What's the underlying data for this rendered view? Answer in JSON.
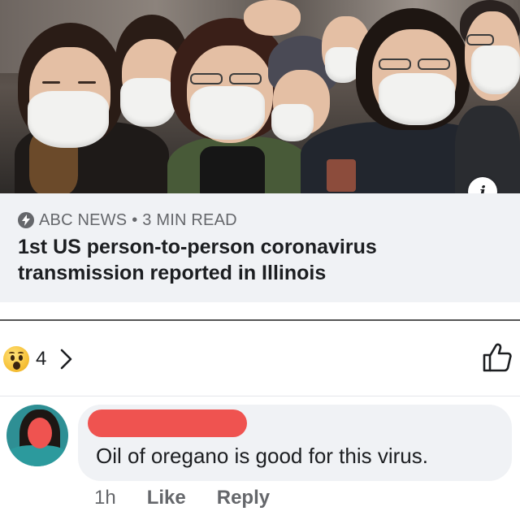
{
  "article": {
    "source": "ABC NEWS",
    "separator": "•",
    "read_time": "3 MIN READ",
    "headline": "1st US person-to-person coronavirus transmission reported in Illinois",
    "photo_icon": "info-icon",
    "info_glyph": "i"
  },
  "reactions": {
    "type_icon": "wow-reaction-icon",
    "count": "4",
    "more_icon": "chevron-right-icon",
    "like_icon": "thumbs-up-icon"
  },
  "comment": {
    "author_redacted": true,
    "text": "Oil of oregano is good for this virus.",
    "time": "1h",
    "like_label": "Like",
    "reply_label": "Reply"
  },
  "colors": {
    "secondary_text": "#65676b",
    "primary_text": "#1c1e21",
    "card_bg": "#f0f2f5",
    "redaction": "#ef5350"
  }
}
